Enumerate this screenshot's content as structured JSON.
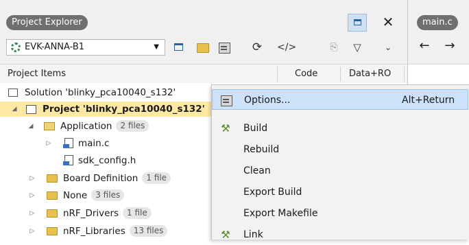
{
  "project_explorer": {
    "title": "Project Explorer",
    "project_dropdown": "EVK-ANNA-B1",
    "columns": [
      "Project Items",
      "Code",
      "Data+RO"
    ]
  },
  "tree": {
    "solution": "Solution 'blinky_pca10040_s132'",
    "project": "Project 'blinky_pca10040_s132'",
    "application": {
      "label": "Application",
      "badge": "2 files"
    },
    "main_c": "main.c",
    "sdk_config": "sdk_config.h",
    "board_definition": {
      "label": "Board Definition",
      "badge": "1 file"
    },
    "none": {
      "label": "None",
      "badge": "3 files"
    },
    "nrf_drivers": {
      "label": "nRF_Drivers",
      "badge": "1 file"
    },
    "nrf_libraries": {
      "label": "nRF_Libraries",
      "badge": "13 files"
    }
  },
  "context_menu": {
    "options": {
      "label": "Options...",
      "shortcut": "Alt+Return"
    },
    "build": "Build",
    "rebuild": "Rebuild",
    "clean": "Clean",
    "export_build": "Export Build",
    "export_makefile": "Export Makefile",
    "link": "Link"
  },
  "editor": {
    "tab": "main.c"
  },
  "icons": {
    "close": "close-icon",
    "maximize": "maximize-icon",
    "back": "arrow-left-icon",
    "forward": "arrow-right-icon"
  }
}
